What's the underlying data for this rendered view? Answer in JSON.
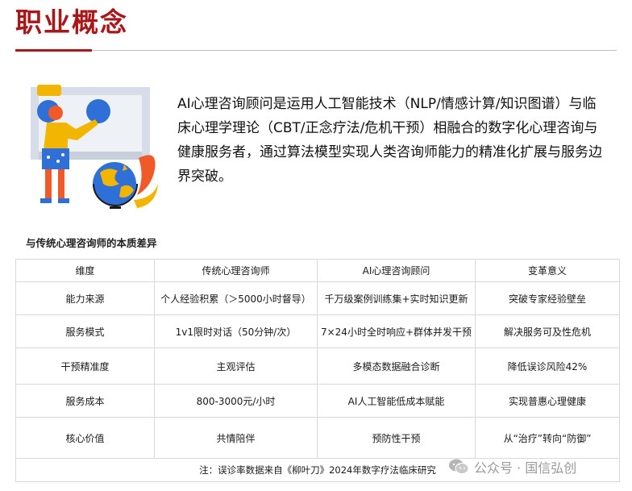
{
  "page": {
    "title": "职业概念",
    "intro": "AI心理咨询顾问是运用人工智能技术（NLP/情感计算/知识图谱）与临床心理学理论（CBT/正念疗法/危机干预）相融合的数字化心理咨询与健康服务者，通过算法模型实现人类咨询师能力的精准化扩展与服务边界突破。",
    "subtitle": "与传统心理咨询师的本质差异"
  },
  "table": {
    "headers": [
      "维度",
      "传统心理咨询师",
      "AI心理咨询顾问",
      "变革意义"
    ],
    "rows": [
      [
        "能力来源",
        "个人经验积累（＞5000小时督导）",
        "千万级案例训练集+实时知识更新",
        "突破专家经验壁垒"
      ],
      [
        "服务模式",
        "1v1限时对话（50分钟/次）",
        "7×24小时全时响应+群体并发干预",
        "解决服务可及性危机"
      ],
      [
        "干预精准度",
        "主观评估",
        "多模态数据融合诊断",
        "降低误诊风险42%"
      ],
      [
        "服务成本",
        "800-3000元/小时",
        "AI人工智能低成本赋能",
        "实现普惠心理健康"
      ],
      [
        "核心价值",
        "共情陪伴",
        "预防性干预",
        "从“治疗”转向“防御”"
      ]
    ],
    "note": "注：误诊率数据来自《柳叶刀》2024年数字疗法临床研究"
  },
  "watermark": {
    "text": "公众号 · 国信弘创",
    "icon": "wechat-icon"
  },
  "colors": {
    "title": "#a8181b",
    "rule": "#a8181b",
    "illustration_blue": "#2f6fd8",
    "illustration_yellow": "#f2b600",
    "illustration_orange": "#f05a28"
  }
}
